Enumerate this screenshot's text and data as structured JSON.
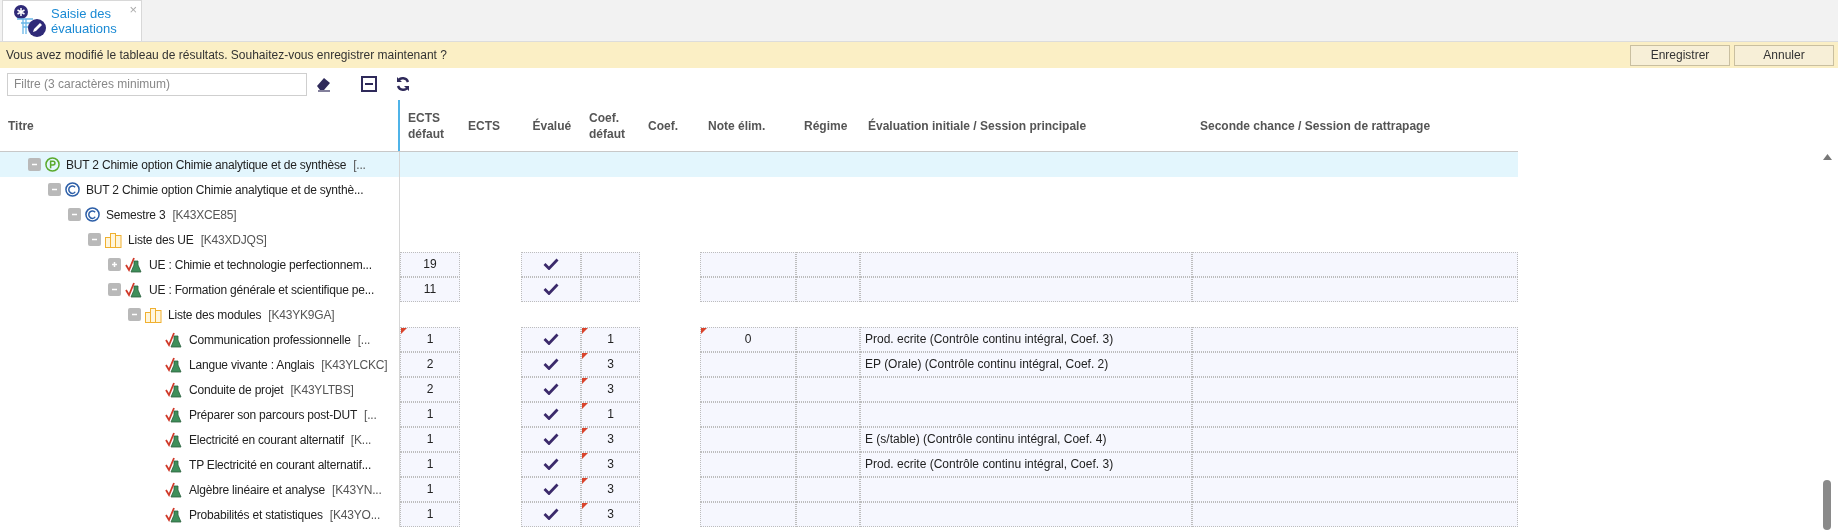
{
  "tab": {
    "label": "Saisie des évaluations",
    "close": "×",
    "selected": true
  },
  "banner": {
    "message": "Vous avez modifié le tableau de résultats. Souhaitez-vous enregistrer maintenant ?",
    "buttons": [
      "Enregistrer",
      "Annuler"
    ]
  },
  "filter": {
    "placeholder": "Filtre (3 caractères minimum)"
  },
  "columns": [
    {
      "label": "Titre",
      "kind": "tree"
    },
    {
      "label": "ECTS défaut",
      "kind": "input-number"
    },
    {
      "label": "ECTS",
      "kind": "readonly-number"
    },
    {
      "label": "Évalué",
      "kind": "check"
    },
    {
      "label": "Coef. défaut",
      "kind": "input-number"
    },
    {
      "label": "Coef.",
      "kind": "readonly-number"
    },
    {
      "label": "Note élim.",
      "kind": "input-number"
    },
    {
      "label": "Régime",
      "kind": "input-text"
    },
    {
      "label": "Évaluation initiale / Session principale",
      "kind": "input-text"
    },
    {
      "label": "Seconde chance / Session de rattrapage",
      "kind": "input-text"
    }
  ],
  "tree": [
    {
      "kind": "programme",
      "title": "BUT 2 Chimie option Chimie analytique et de synthèse",
      "code": "[...",
      "expanded": true,
      "selected": true,
      "editable": false,
      "children": [
        {
          "kind": "component",
          "title": "BUT 2 Chimie option Chimie analytique et de synthè...",
          "expanded": true,
          "selected": false,
          "editable": false,
          "children": [
            {
              "kind": "component",
              "title": "Semestre 3",
              "code": "[K43XCE85]",
              "expanded": true,
              "selected": false,
              "editable": false,
              "children": [
                {
                  "kind": "list",
                  "title": "Liste des UE",
                  "code": "[K43XDJQS]",
                  "expanded": true,
                  "selected": false,
                  "editable": false,
                  "children": [
                    {
                      "kind": "ue",
                      "title": "UE : Chimie et technologie perfectionnem...",
                      "expanded": false,
                      "selected": false,
                      "editable": true,
                      "cells": {
                        "ects_default": {
                          "text": "19",
                          "modified": false
                        },
                        "evaluated": {
                          "checked": true
                        }
                      }
                    },
                    {
                      "kind": "ue",
                      "title": "UE : Formation générale et scientifique pe...",
                      "expanded": true,
                      "selected": false,
                      "editable": true,
                      "cells": {
                        "ects_default": {
                          "text": "11",
                          "modified": false
                        },
                        "evaluated": {
                          "checked": true
                        }
                      },
                      "children": [
                        {
                          "kind": "list",
                          "title": "Liste des modules",
                          "code": "[K43YK9GA]",
                          "expanded": true,
                          "selected": false,
                          "editable": false,
                          "children": [
                            {
                              "kind": "module",
                              "title": "Communication professionnelle",
                              "code": "[...",
                              "selected": false,
                              "editable": true,
                              "cells": {
                                "ects_default": {
                                  "text": "1",
                                  "modified": true
                                },
                                "evaluated": {
                                  "checked": true
                                },
                                "coef_default": {
                                  "text": "1",
                                  "modified": true
                                },
                                "note_elim": {
                                  "text": "0",
                                  "modified": true
                                },
                                "eval_initial": {
                                  "text": "Prod. ecrite (Contrôle continu intégral, Coef. 3)",
                                  "modified": false
                                }
                              }
                            },
                            {
                              "kind": "module",
                              "title": "Langue vivante : Anglais",
                              "code": "[K43YLCKC]",
                              "selected": false,
                              "editable": true,
                              "cells": {
                                "ects_default": {
                                  "text": "2",
                                  "modified": false
                                },
                                "evaluated": {
                                  "checked": true
                                },
                                "coef_default": {
                                  "text": "3",
                                  "modified": true
                                },
                                "eval_initial": {
                                  "text": "EP (Orale) (Contrôle continu intégral, Coef. 2)",
                                  "modified": false
                                }
                              }
                            },
                            {
                              "kind": "module",
                              "title": "Conduite de projet",
                              "code": "[K43YLTBS]",
                              "selected": false,
                              "editable": true,
                              "cells": {
                                "ects_default": {
                                  "text": "2",
                                  "modified": false
                                },
                                "evaluated": {
                                  "checked": true
                                },
                                "coef_default": {
                                  "text": "3",
                                  "modified": true
                                }
                              }
                            },
                            {
                              "kind": "module",
                              "title": "Préparer son parcours post-DUT",
                              "code": "[...",
                              "selected": false,
                              "editable": true,
                              "cells": {
                                "ects_default": {
                                  "text": "1",
                                  "modified": false
                                },
                                "evaluated": {
                                  "checked": true
                                },
                                "coef_default": {
                                  "text": "1",
                                  "modified": true
                                }
                              }
                            },
                            {
                              "kind": "module",
                              "title": "Electricité en courant alternatif",
                              "code": "[K...",
                              "selected": false,
                              "editable": true,
                              "cells": {
                                "ects_default": {
                                  "text": "1",
                                  "modified": false
                                },
                                "evaluated": {
                                  "checked": true
                                },
                                "coef_default": {
                                  "text": "3",
                                  "modified": true
                                },
                                "eval_initial": {
                                  "text": "E (s/table) (Contrôle continu intégral, Coef. 4)",
                                  "modified": false
                                }
                              }
                            },
                            {
                              "kind": "module",
                              "title": "TP Electricité en courant alternatif...",
                              "selected": false,
                              "editable": true,
                              "cells": {
                                "ects_default": {
                                  "text": "1",
                                  "modified": false
                                },
                                "evaluated": {
                                  "checked": true
                                },
                                "coef_default": {
                                  "text": "3",
                                  "modified": true
                                },
                                "eval_initial": {
                                  "text": "Prod. ecrite (Contrôle continu intégral, Coef. 3)",
                                  "modified": false
                                }
                              }
                            },
                            {
                              "kind": "module",
                              "title": "Algèbre linéaire et analyse",
                              "code": "[K43YN...",
                              "selected": false,
                              "editable": true,
                              "cells": {
                                "ects_default": {
                                  "text": "1",
                                  "modified": false
                                },
                                "evaluated": {
                                  "checked": true
                                },
                                "coef_default": {
                                  "text": "3",
                                  "modified": true
                                }
                              }
                            },
                            {
                              "kind": "module",
                              "title": "Probabilités et statistiques",
                              "code": "[K43YO...",
                              "selected": false,
                              "editable": true,
                              "cells": {
                                "ects_default": {
                                  "text": "1",
                                  "modified": false
                                },
                                "evaluated": {
                                  "checked": true
                                },
                                "coef_default": {
                                  "text": "3",
                                  "modified": true
                                }
                              }
                            }
                          ]
                        }
                      ]
                    }
                  ]
                }
              ]
            }
          ]
        }
      ]
    }
  ]
}
